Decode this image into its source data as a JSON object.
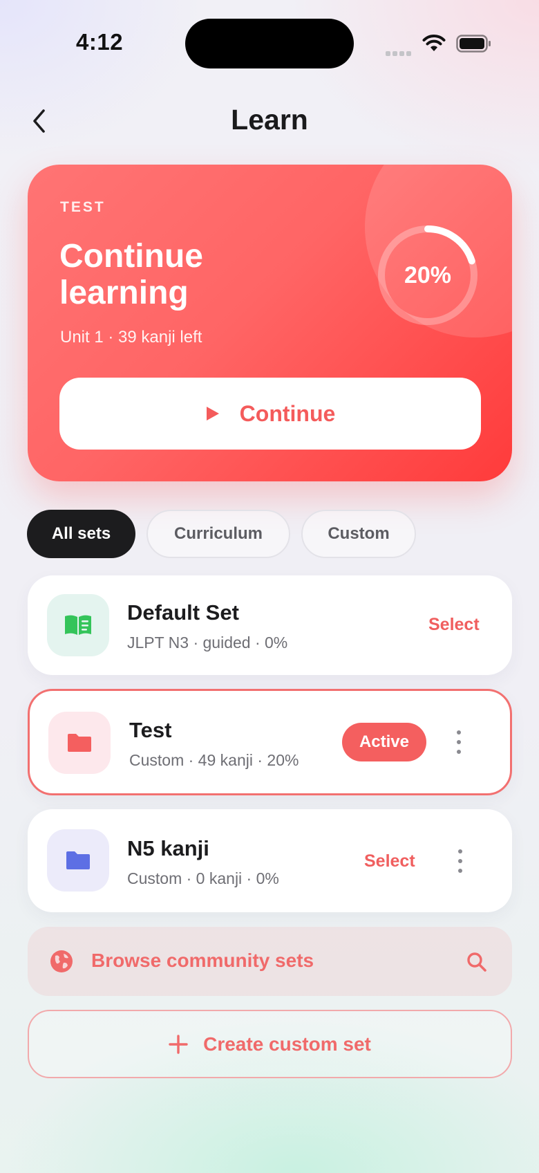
{
  "status_bar": {
    "time": "4:12"
  },
  "header": {
    "title": "Learn"
  },
  "hero": {
    "label": "TEST",
    "title": "Continue learning",
    "subtitle": "Unit 1 · 39 kanji left",
    "progress_percent": 20,
    "progress_text": "20%",
    "button_label": "Continue",
    "accent": "#ff6565"
  },
  "tabs": [
    {
      "label": "All sets",
      "selected": true
    },
    {
      "label": "Curriculum",
      "selected": false
    },
    {
      "label": "Custom",
      "selected": false
    }
  ],
  "sets": [
    {
      "name": "Default Set",
      "meta": "JLPT N3 · guided · 0%",
      "action": "Select",
      "icon": "book-icon",
      "icon_color": "#34c45a",
      "icon_bg": "#e4f4ef"
    },
    {
      "name": "Test",
      "meta": "Custom · 49 kanji · 20%",
      "badge": "Active",
      "icon": "folder-icon",
      "icon_color": "#f45f5f",
      "icon_bg": "#fde8ec"
    },
    {
      "name": "N5 kanji",
      "meta": "Custom · 0 kanji · 0%",
      "action": "Select",
      "icon": "folder-icon",
      "icon_color": "#5d6fe4",
      "icon_bg": "#ecebfa"
    }
  ],
  "browse": {
    "label": "Browse community sets"
  },
  "create": {
    "label": "Create custom set"
  },
  "colors": {
    "accent": "#f45f5f",
    "dark": "#1c1c1e"
  }
}
